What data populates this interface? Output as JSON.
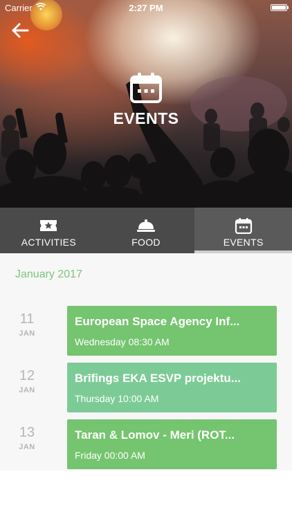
{
  "status_bar": {
    "carrier": "Carrier",
    "time": "2:27 PM"
  },
  "hero": {
    "title": "EVENTS",
    "icon": "calendar-icon"
  },
  "tabs": [
    {
      "label": "ACTIVITIES",
      "icon": "ticket-star-icon",
      "active": false
    },
    {
      "label": "FOOD",
      "icon": "cloche-icon",
      "active": false
    },
    {
      "label": "EVENTS",
      "icon": "calendar-icon",
      "active": true
    }
  ],
  "month_header": "January 2017",
  "events": [
    {
      "day": "11",
      "month": "JAN",
      "title": "European Space Agency Inf...",
      "time": "Wednesday 08:30 AM",
      "color": "#75c46f"
    },
    {
      "day": "12",
      "month": "JAN",
      "title": "Brīfings EKA ESVP projektu...",
      "time": "Thursday 10:00 AM",
      "color": "#7ccb96"
    },
    {
      "day": "13",
      "month": "JAN",
      "title": "Taran & Lomov - Meri (ROT...",
      "time": "Friday 00:00 AM",
      "color": "#75c46f"
    }
  ],
  "colors": {
    "accent": "#7cc57a",
    "tab_bar": "#4a4a4a"
  }
}
